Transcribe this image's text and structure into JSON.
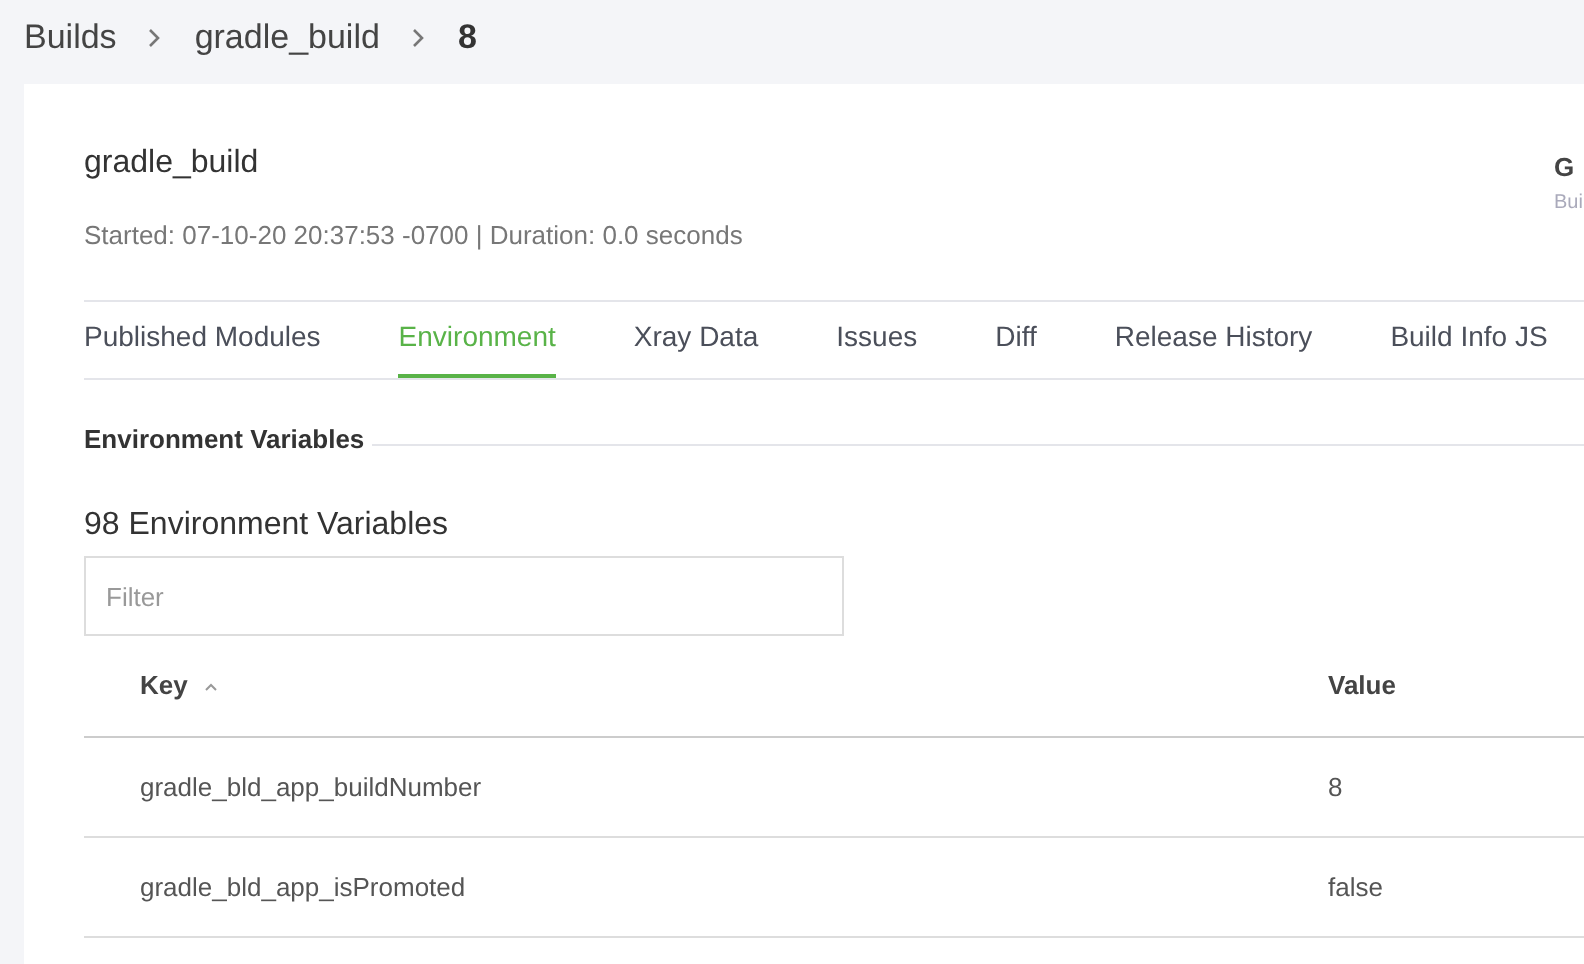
{
  "breadcrumbs": [
    {
      "label": "Builds",
      "current": false
    },
    {
      "label": "gradle_build",
      "current": false
    },
    {
      "label": "8",
      "current": true
    }
  ],
  "build": {
    "title": "gradle_build",
    "meta": "Started: 07-10-20 20:37:53 -0700 | Duration: 0.0 seconds",
    "side_title": "G",
    "side_subtitle": "Bui"
  },
  "tabs": [
    {
      "label": "Published Modules",
      "selected": false
    },
    {
      "label": "Environment",
      "selected": true
    },
    {
      "label": "Xray Data",
      "selected": false
    },
    {
      "label": "Issues",
      "selected": false
    },
    {
      "label": "Diff",
      "selected": false
    },
    {
      "label": "Release History",
      "selected": false
    },
    {
      "label": "Build Info JS",
      "selected": false
    }
  ],
  "section_title": "Environment Variables",
  "count_title": "98 Environment Variables",
  "filter": {
    "placeholder": "Filter"
  },
  "table": {
    "columns": [
      {
        "label": "Key",
        "sorted": true
      },
      {
        "label": "Value",
        "sorted": false
      }
    ],
    "rows": [
      [
        "gradle_bld_app_buildNumber",
        "8"
      ],
      [
        "gradle_bld_app_isPromoted",
        "false"
      ]
    ]
  }
}
